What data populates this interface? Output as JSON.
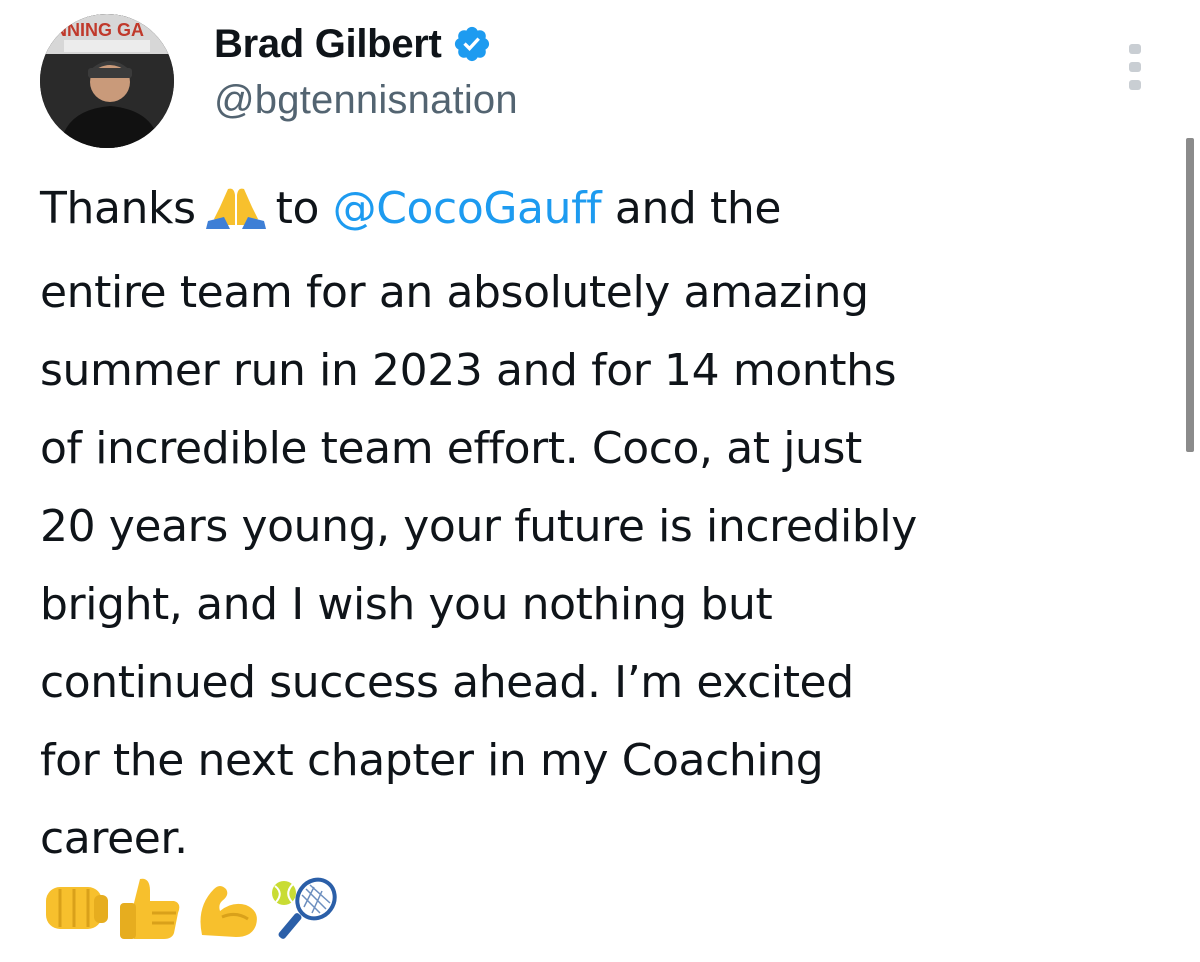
{
  "author": {
    "display_name": "Brad Gilbert",
    "handle": "@bgtennisnation",
    "avatar_banner_text": "NNING GA"
  },
  "icons": {
    "verified": "verified-badge-icon",
    "more": "more-options-icon",
    "inline_emoji": "folded-hands-emoji",
    "trailing_emojis": [
      "fist-bump-emoji",
      "thumbs-up-emoji",
      "flexed-biceps-emoji",
      "tennis-emoji"
    ]
  },
  "tweet": {
    "lines": [
      {
        "before": "Thanks",
        "after_icon": "to",
        "mention": "@CocoGauff",
        "rest": "and the"
      },
      "entire team for an absolutely amazing",
      "summer run in 2023 and for 14 months",
      "of incredible team effort. Coco, at just",
      "20 years young, your future is incredibly",
      "bright, and I wish you nothing but",
      "continued success ahead. I’m excited",
      "for the next chapter in my Coaching",
      "career."
    ]
  },
  "colors": {
    "text": "#0f1419",
    "secondary": "#536471",
    "link": "#1d9bf0",
    "verified": "#1d9bf0",
    "emoji_yellow": "#f7c02d"
  }
}
